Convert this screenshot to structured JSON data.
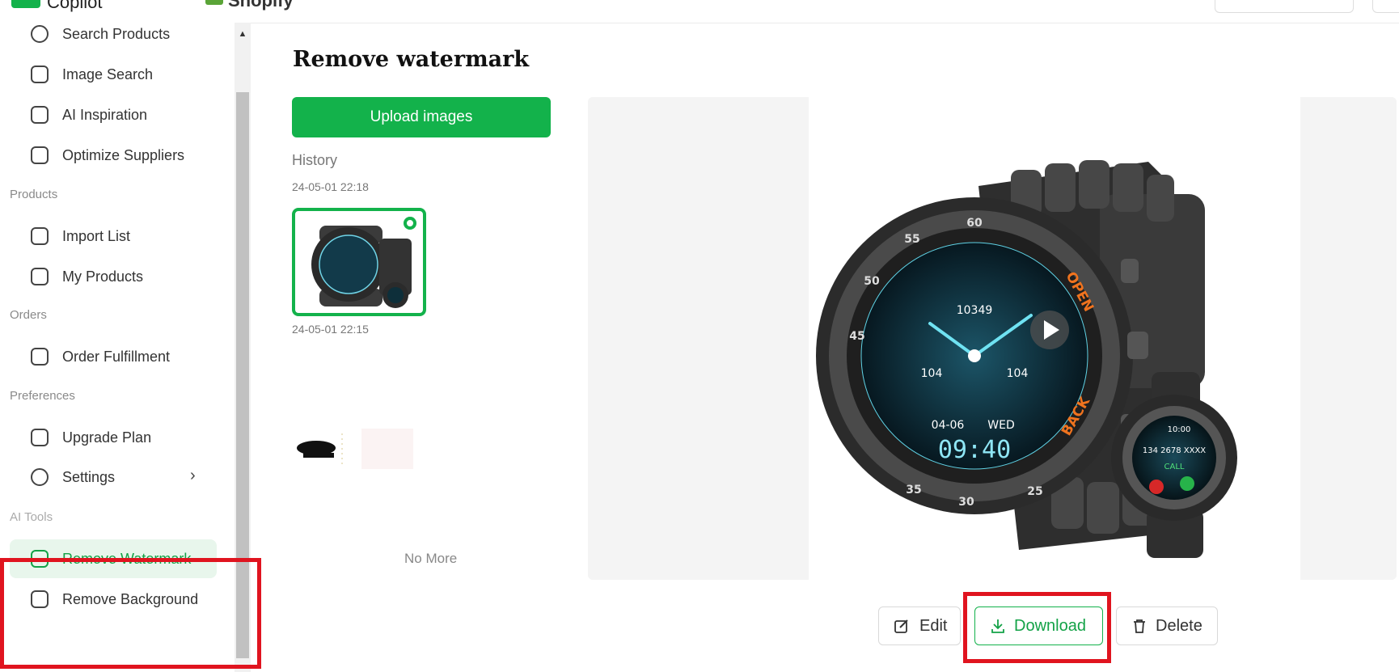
{
  "app": {
    "logo_text": "Copilot",
    "platform_text": "Shopify"
  },
  "sidebar": {
    "top_items": [
      {
        "label": "Search Products"
      },
      {
        "label": "Image Search"
      },
      {
        "label": "AI Inspiration"
      },
      {
        "label": "Optimize Suppliers"
      }
    ],
    "sections": {
      "products": {
        "title": "Products",
        "items": [
          {
            "label": "Import List"
          },
          {
            "label": "My Products"
          }
        ]
      },
      "orders": {
        "title": "Orders",
        "items": [
          {
            "label": "Order Fulfillment"
          }
        ]
      },
      "preferences": {
        "title": "Preferences",
        "items": [
          {
            "label": "Upgrade Plan"
          },
          {
            "label": "Settings"
          }
        ]
      },
      "ai_tools": {
        "title": "AI Tools",
        "items": [
          {
            "label": "Remove Watermark",
            "active": true
          },
          {
            "label": "Remove Background"
          }
        ]
      }
    }
  },
  "main": {
    "title": "Remove watermark",
    "upload_label": "Upload images",
    "history_label": "History",
    "history": [
      {
        "timestamp": "24-05-01 22:18",
        "selected": true
      },
      {
        "timestamp": "24-05-01 22:15",
        "selected": false
      }
    ],
    "no_more": "No More",
    "preview": {
      "watch_texts": [
        "60",
        "55",
        "50",
        "45",
        "35",
        "30",
        "25",
        "OPEN",
        "BACK",
        "10349",
        "104",
        "104",
        "04-06",
        "WED",
        "09:40",
        "10:00",
        "134 2678 XXXX",
        "CALL"
      ]
    },
    "actions": {
      "edit": "Edit",
      "download": "Download",
      "delete": "Delete"
    }
  },
  "colors": {
    "accent": "#13b24b",
    "highlight": "#e0141f",
    "active_bg": "#e8f6ec"
  }
}
